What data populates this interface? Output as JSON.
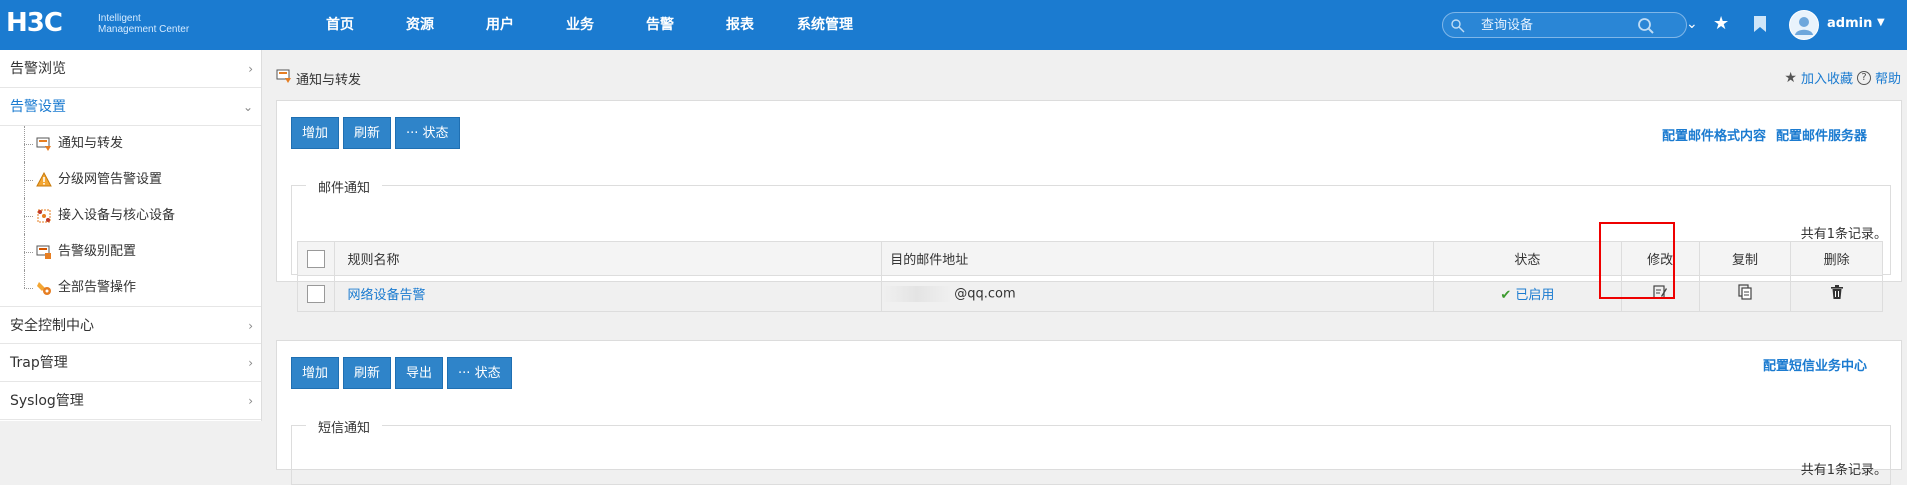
{
  "header": {
    "logo": "H3C",
    "logo_sub_1": "Intelligent",
    "logo_sub_2": "Management Center",
    "nav": [
      "首页",
      "资源",
      "用户",
      "业务",
      "告警",
      "报表",
      "系统管理"
    ],
    "search_placeholder": "查询设备",
    "user": "admin"
  },
  "sidebar": {
    "categories": [
      {
        "label": "告警浏览",
        "chevron": "›"
      },
      {
        "label": "告警设置",
        "chevron": "⌄"
      }
    ],
    "sub_items": [
      "通知与转发",
      "分级网管告警设置",
      "接入设备与核心设备",
      "告警级别配置",
      "全部告警操作"
    ],
    "bottom_categories": [
      {
        "label": "安全控制中心",
        "chevron": "›"
      },
      {
        "label": "Trap管理",
        "chevron": "›"
      },
      {
        "label": "Syslog管理",
        "chevron": "›"
      }
    ]
  },
  "breadcrumb": "通知与转发",
  "toplinks": {
    "favorite": "加入收藏",
    "help": "帮助"
  },
  "email_panel": {
    "buttons": [
      "增加",
      "刷新",
      "··· 状态"
    ],
    "links": [
      "配置邮件格式内容",
      "配置邮件服务器"
    ],
    "legend": "邮件通知",
    "count": "共有1条记录。",
    "columns": [
      "规则名称",
      "目的邮件地址",
      "状态",
      "修改",
      "复制",
      "删除"
    ],
    "rows": [
      {
        "name": "网络设备告警",
        "email": "@qq.com",
        "status": "已启用"
      }
    ]
  },
  "sms_panel": {
    "buttons": [
      "增加",
      "刷新",
      "导出",
      "··· 状态"
    ],
    "link": "配置短信业务中心",
    "legend": "短信通知",
    "count": "共有1条记录。"
  },
  "colors": {
    "header": "#1b7bd0",
    "button": "#2f84c9",
    "highlight": "#ee0000",
    "status_ok": "#3c9a2e"
  }
}
